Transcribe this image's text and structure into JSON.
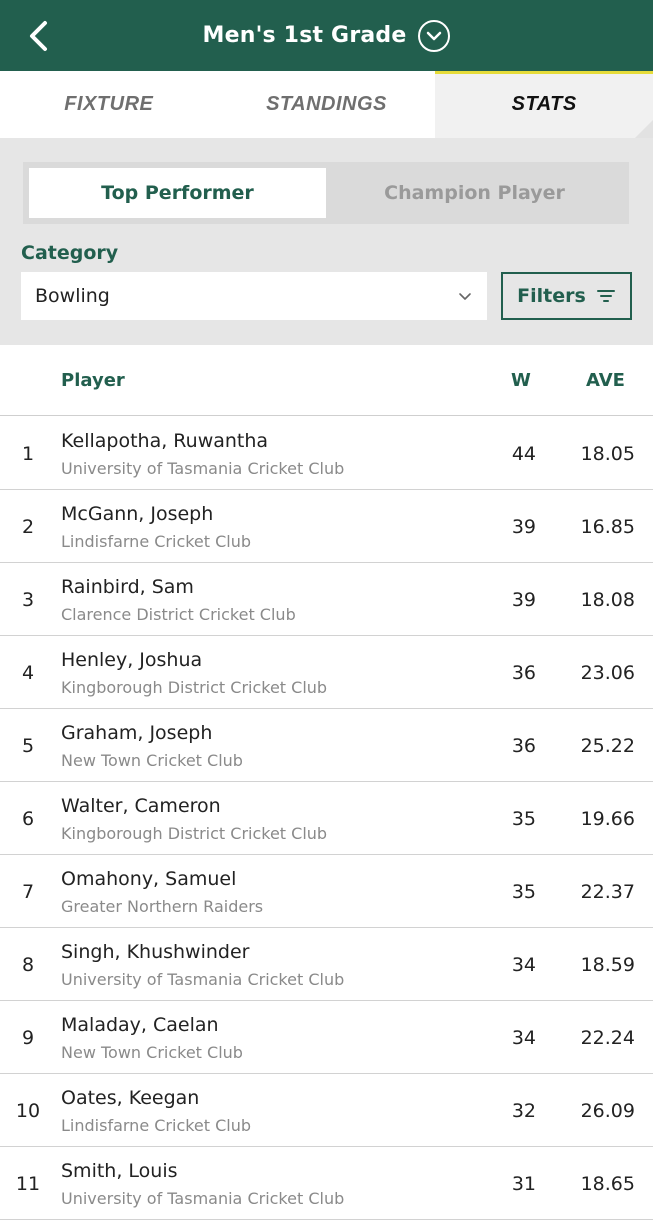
{
  "header": {
    "title": "Men's 1st Grade"
  },
  "tabs": [
    {
      "label": "FIXTURE"
    },
    {
      "label": "STANDINGS"
    },
    {
      "label": "STATS"
    }
  ],
  "segment": {
    "top_performer": "Top Performer",
    "champion_player": "Champion Player"
  },
  "category": {
    "label": "Category",
    "value": "Bowling",
    "filters_label": "Filters"
  },
  "table": {
    "headers": {
      "player": "Player",
      "w": "W",
      "ave": "AVE"
    },
    "rows": [
      {
        "rank": "1",
        "name": "Kellapotha, Ruwantha",
        "club": "University of Tasmania Cricket Club",
        "w": "44",
        "ave": "18.05"
      },
      {
        "rank": "2",
        "name": "McGann, Joseph",
        "club": "Lindisfarne Cricket Club",
        "w": "39",
        "ave": "16.85"
      },
      {
        "rank": "3",
        "name": "Rainbird, Sam",
        "club": "Clarence District Cricket Club",
        "w": "39",
        "ave": "18.08"
      },
      {
        "rank": "4",
        "name": "Henley, Joshua",
        "club": "Kingborough District Cricket Club",
        "w": "36",
        "ave": "23.06"
      },
      {
        "rank": "5",
        "name": "Graham, Joseph",
        "club": "New Town Cricket Club",
        "w": "36",
        "ave": "25.22"
      },
      {
        "rank": "6",
        "name": "Walter, Cameron",
        "club": "Kingborough District Cricket Club",
        "w": "35",
        "ave": "19.66"
      },
      {
        "rank": "7",
        "name": "Omahony, Samuel",
        "club": "Greater Northern Raiders",
        "w": "35",
        "ave": "22.37"
      },
      {
        "rank": "8",
        "name": "Singh, Khushwinder",
        "club": "University of Tasmania Cricket Club",
        "w": "34",
        "ave": "18.59"
      },
      {
        "rank": "9",
        "name": "Maladay, Caelan",
        "club": "New Town Cricket Club",
        "w": "34",
        "ave": "22.24"
      },
      {
        "rank": "10",
        "name": "Oates, Keegan",
        "club": "Lindisfarne Cricket Club",
        "w": "32",
        "ave": "26.09"
      },
      {
        "rank": "11",
        "name": "Smith, Louis",
        "club": "University of Tasmania Cricket Club",
        "w": "31",
        "ave": "18.65"
      }
    ]
  },
  "colors": {
    "brand_green": "#225f4e",
    "accent_yellow": "#e6dc3a"
  }
}
